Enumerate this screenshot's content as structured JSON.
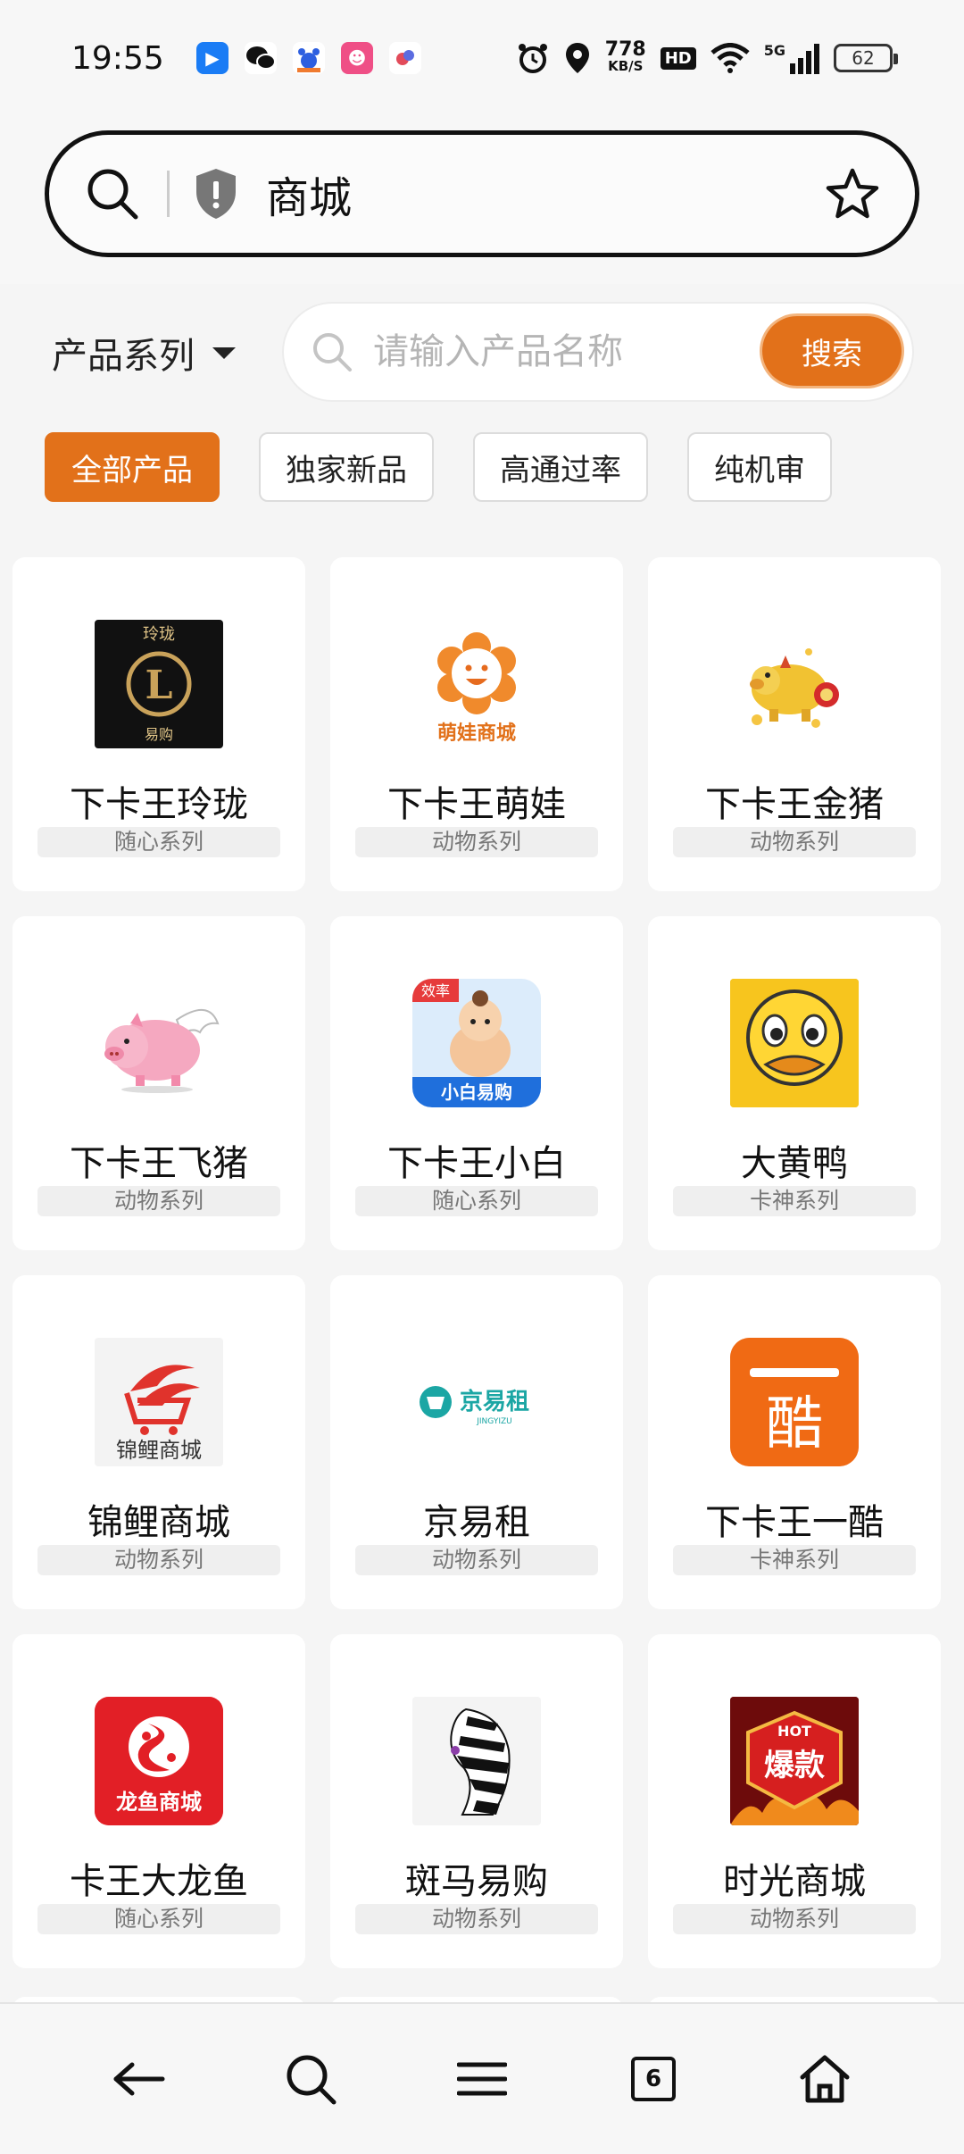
{
  "status_bar": {
    "time": "19:55",
    "speed_value": "778",
    "speed_unit": "KB/S",
    "hd": "HD",
    "network": "5G",
    "battery": "62"
  },
  "browser": {
    "url_text": "商城"
  },
  "page": {
    "series_select": "产品系列",
    "search_placeholder": "请输入产品名称",
    "search_button": "搜索",
    "tabs": [
      "全部产品",
      "独家新品",
      "高通过率",
      "纯机审"
    ],
    "active_tab": "全部产品",
    "products": [
      {
        "name": "下卡王玲珑",
        "tag": "随心系列",
        "logo_text": "玲珑 L 易购"
      },
      {
        "name": "下卡王萌娃",
        "tag": "动物系列",
        "logo_text": "萌娃商城"
      },
      {
        "name": "下卡王金猪",
        "tag": "动物系列",
        "logo_text": ""
      },
      {
        "name": "下卡王飞猪",
        "tag": "动物系列",
        "logo_text": ""
      },
      {
        "name": "下卡王小白",
        "tag": "随心系列",
        "logo_text": "效率 小白易购"
      },
      {
        "name": "大黄鸭",
        "tag": "卡神系列",
        "logo_text": ""
      },
      {
        "name": "锦鲤商城",
        "tag": "动物系列",
        "logo_text": "锦鲤商城"
      },
      {
        "name": "京易租",
        "tag": "动物系列",
        "logo_text": "京易租"
      },
      {
        "name": "下卡王一酷",
        "tag": "卡神系列",
        "logo_text": "一酷"
      },
      {
        "name": "卡王大龙鱼",
        "tag": "随心系列",
        "logo_text": "龙鱼商城"
      },
      {
        "name": "斑马易购",
        "tag": "动物系列",
        "logo_text": ""
      },
      {
        "name": "时光商城",
        "tag": "动物系列",
        "logo_text": "HOT 爆款"
      }
    ]
  },
  "bottom_nav": {
    "tab_count": "6"
  },
  "colors": {
    "accent": "#e2711a",
    "tag_bg": "#efefef"
  }
}
